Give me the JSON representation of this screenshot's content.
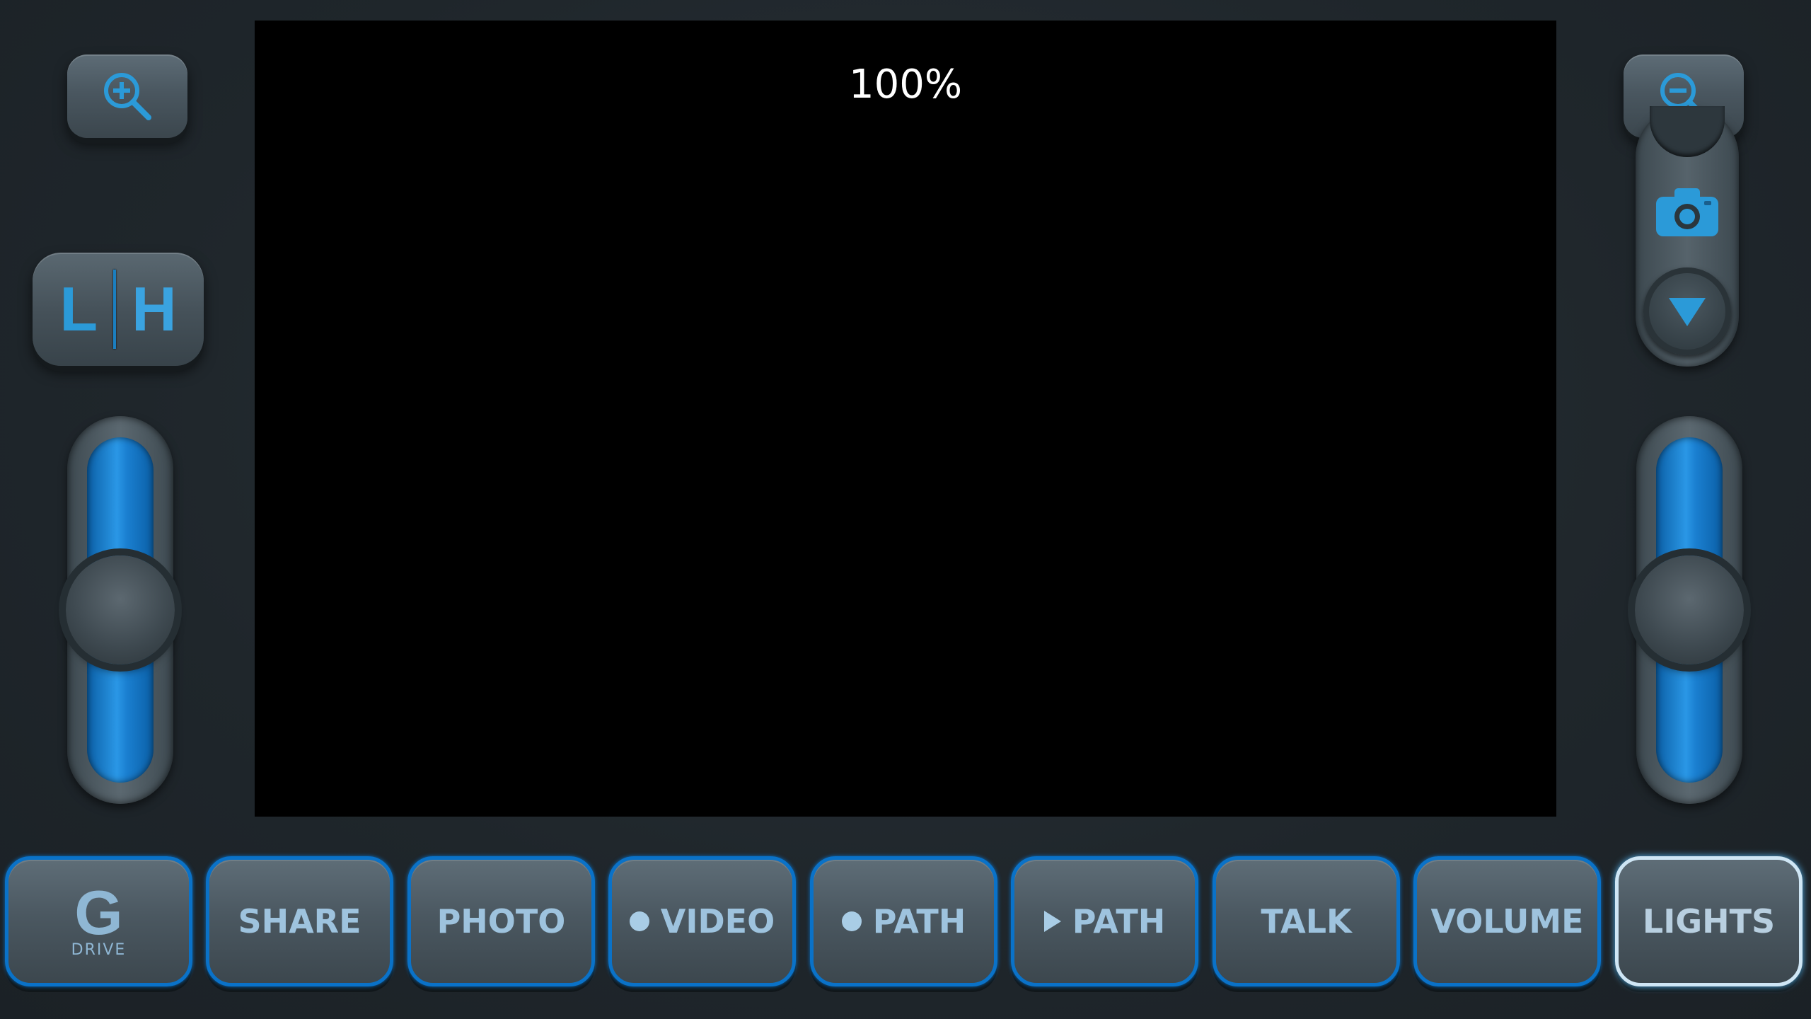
{
  "viewport": {
    "zoom_level": "100%"
  },
  "controls": {
    "zoom_in": {
      "icon": "zoom-in-icon"
    },
    "zoom_out": {
      "icon": "zoom-out-icon"
    },
    "speed_toggle": {
      "low_label": "L",
      "high_label": "H"
    },
    "camera": {
      "icon": "camera-icon"
    },
    "tilt_down": {
      "icon": "triangle-down-icon"
    },
    "left_slider": {
      "level": 0.5
    },
    "right_slider": {
      "level": 0.5
    }
  },
  "toolbar": {
    "drive": {
      "logo": "G",
      "sub": "DRIVE"
    },
    "share": "SHARE",
    "photo": "PHOTO",
    "video": "VIDEO",
    "record_path": "PATH",
    "play_path": "PATH",
    "talk": "TALK",
    "volume": "VOLUME",
    "lights": "LIGHTS"
  },
  "colors": {
    "accent": "#0a72c8",
    "icon_blue": "#2b9ad8",
    "background": "#1f262b"
  }
}
